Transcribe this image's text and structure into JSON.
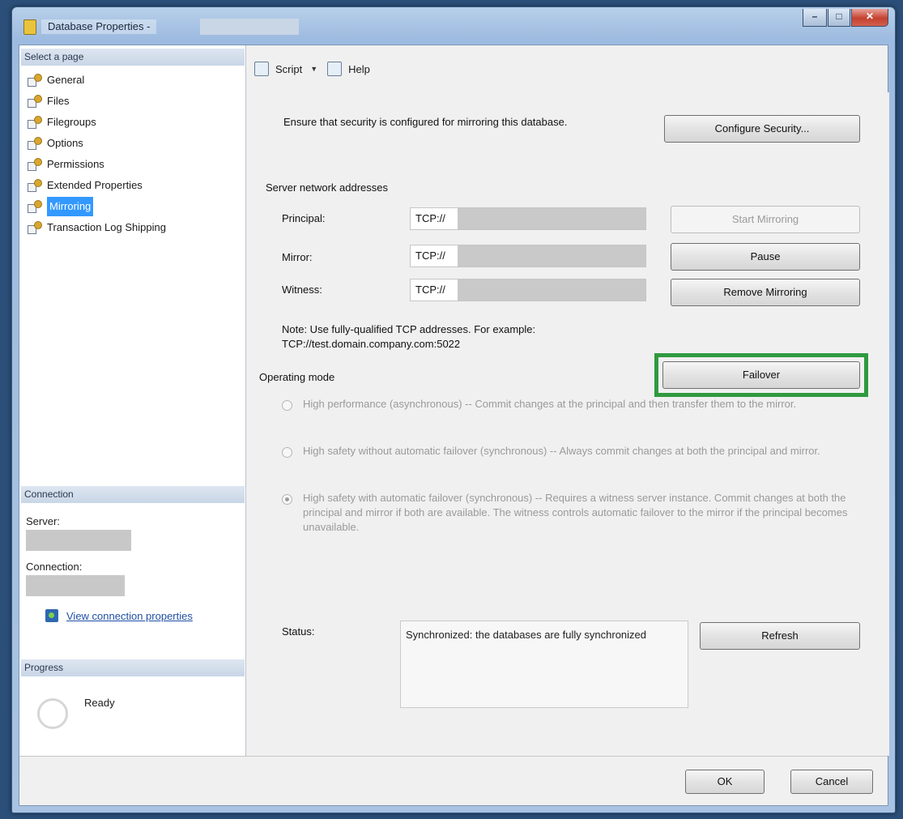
{
  "window": {
    "title": "Database Properties - "
  },
  "sidebar": {
    "header": "Select a page",
    "pages": [
      {
        "label": "General"
      },
      {
        "label": "Files"
      },
      {
        "label": "Filegroups"
      },
      {
        "label": "Options"
      },
      {
        "label": "Permissions"
      },
      {
        "label": "Extended Properties"
      },
      {
        "label": "Mirroring"
      },
      {
        "label": "Transaction Log Shipping"
      }
    ],
    "connection": {
      "header": "Connection",
      "server_label": "Server:",
      "connection_label": "Connection:",
      "link": "View connection properties"
    },
    "progress": {
      "header": "Progress",
      "status": "Ready"
    }
  },
  "toolbar": {
    "script": "Script",
    "help": "Help"
  },
  "mirroring": {
    "security_text": "Ensure that security is configured for mirroring this database.",
    "configure_security": "Configure Security...",
    "server_addresses": "Server network addresses",
    "principal_label": "Principal:",
    "mirror_label": "Mirror:",
    "witness_label": "Witness:",
    "principal_value": "TCP://",
    "mirror_value": "TCP://",
    "witness_value": "TCP://",
    "start_mirroring": "Start Mirroring",
    "pause": "Pause",
    "remove_mirroring": "Remove Mirroring",
    "failover": "Failover",
    "note": "Note: Use fully-qualified TCP addresses. For example:",
    "note_example": "TCP://test.domain.company.com:5022",
    "operating_mode": "Operating mode",
    "modes": [
      {
        "text": "High performance (asynchronous) -- Commit changes at the principal and then transfer them to the mirror."
      },
      {
        "text": "High safety without automatic failover (synchronous) -- Always commit changes at both the principal and mirror."
      },
      {
        "text": "High safety with automatic failover (synchronous) -- Requires a witness server instance. Commit changes at both the principal and mirror if both are available. The witness controls automatic failover to the mirror if the principal becomes unavailable."
      }
    ],
    "status_label": "Status:",
    "status_value": "Synchronized: the databases are fully synchronized",
    "refresh": "Refresh"
  },
  "footer": {
    "ok": "OK",
    "cancel": "Cancel"
  },
  "colors": {
    "highlight": "#2f9a3f",
    "selection": "#3399ff"
  }
}
